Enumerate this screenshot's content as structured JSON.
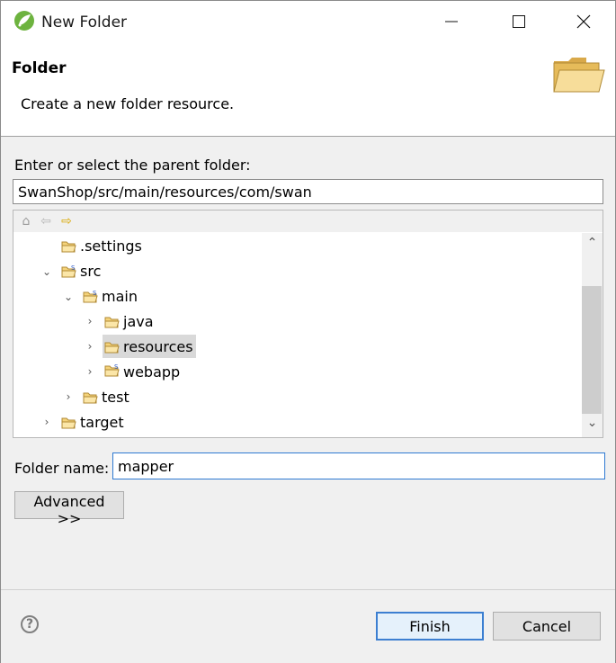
{
  "window": {
    "title": "New Folder"
  },
  "header": {
    "title": "Folder",
    "description": "Create a new folder resource."
  },
  "parent": {
    "label": "Enter or select the parent folder:",
    "value": "SwanShop/src/main/resources/com/swan"
  },
  "tree": {
    "toolbar": [
      "home-icon",
      "back-icon",
      "forward-icon"
    ],
    "items": [
      {
        "label": ".settings",
        "expanded": null,
        "icon": "folder-icon"
      },
      {
        "label": "src",
        "expanded": true,
        "icon": "source-folder-icon"
      },
      {
        "label": "main",
        "expanded": true,
        "icon": "source-folder-icon"
      },
      {
        "label": "java",
        "expanded": false,
        "icon": "folder-icon"
      },
      {
        "label": "resources",
        "expanded": false,
        "icon": "folder-icon",
        "selected": true
      },
      {
        "label": "webapp",
        "expanded": false,
        "icon": "source-folder-icon"
      },
      {
        "label": "test",
        "expanded": false,
        "icon": "folder-icon"
      },
      {
        "label": "target",
        "expanded": false,
        "icon": "folder-icon"
      }
    ]
  },
  "folder_name": {
    "label": "Folder name:",
    "value": "mapper"
  },
  "buttons": {
    "advanced": "Advanced >>",
    "finish": "Finish",
    "cancel": "Cancel"
  },
  "colors": {
    "accent": "#3c7fd1",
    "selection": "#d9d9d9",
    "folder": "#e8b84a"
  }
}
